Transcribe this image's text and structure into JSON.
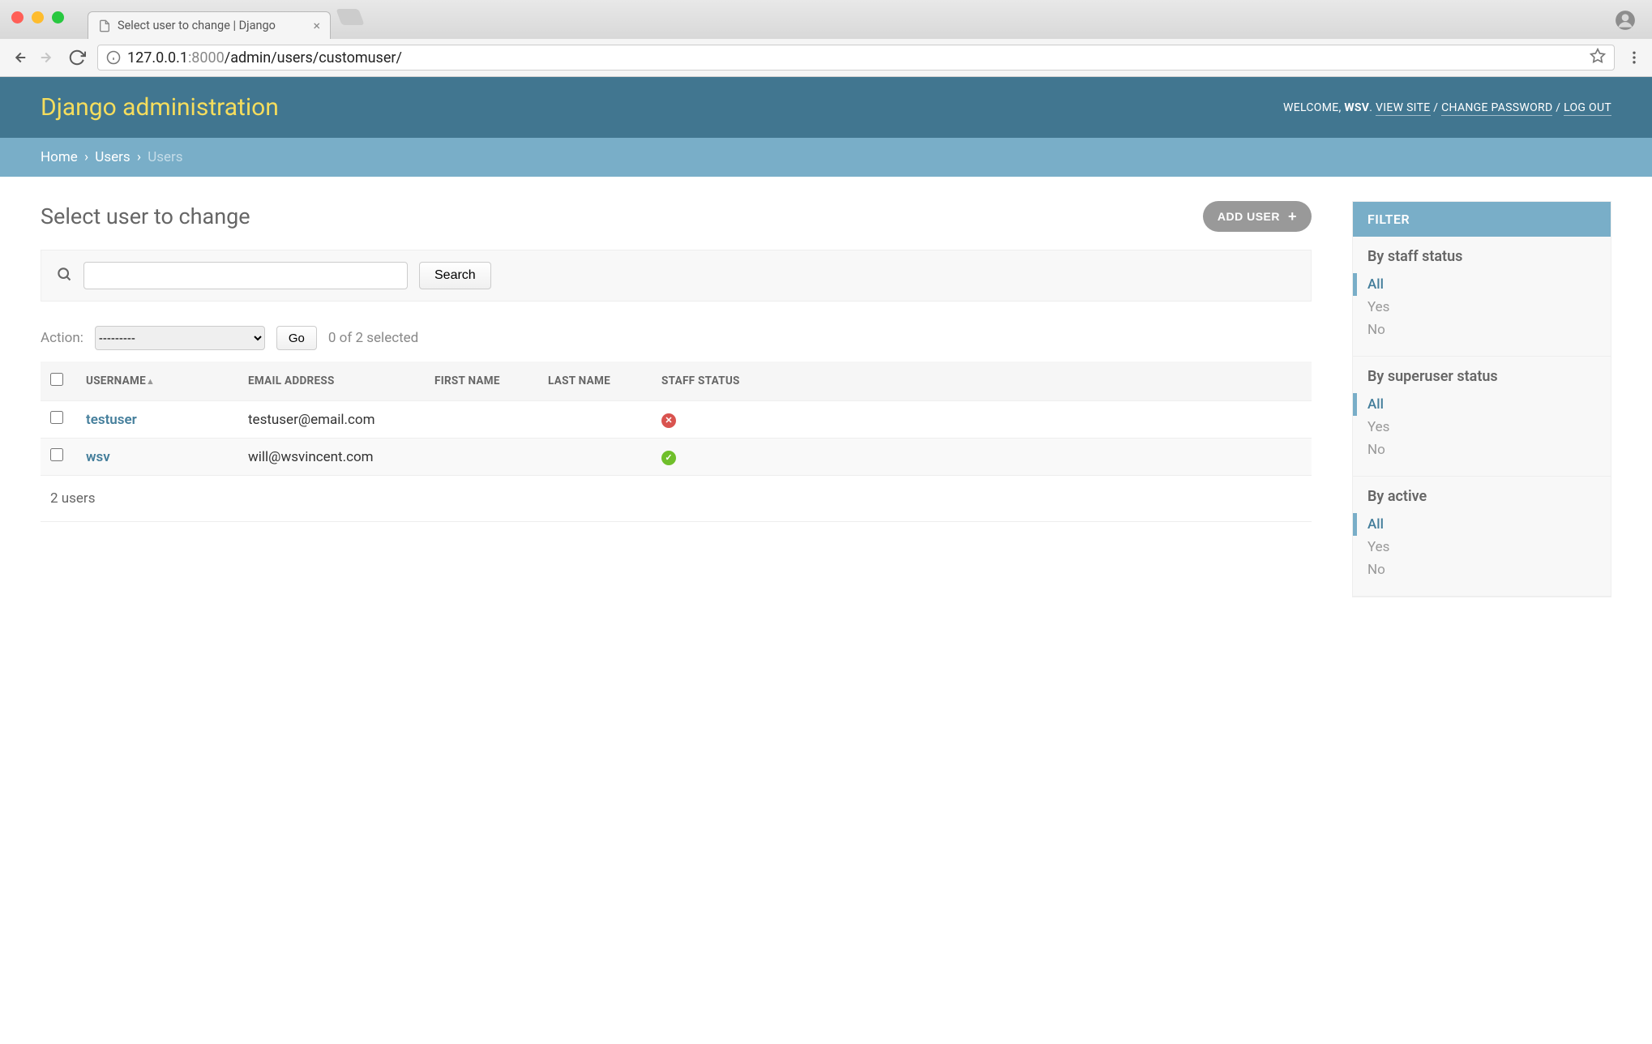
{
  "browser": {
    "tab_title": "Select user to change | Django",
    "url_host": "127.0.0.1",
    "url_port": ":8000",
    "url_path": "/admin/users/customuser/"
  },
  "header": {
    "site_title": "Django administration",
    "welcome": "WELCOME, ",
    "user": "WSV",
    "view_site": "VIEW SITE",
    "change_password": "CHANGE PASSWORD",
    "log_out": "LOG OUT"
  },
  "breadcrumb": {
    "home": "Home",
    "app": "Users",
    "model": "Users"
  },
  "page": {
    "title": "Select user to change",
    "add_button": "ADD USER",
    "search_button": "Search",
    "action_label": "Action:",
    "action_placeholder": "---------",
    "go_label": "Go",
    "selection_text": "0 of 2 selected",
    "count_text": "2 users"
  },
  "columns": {
    "username": "USERNAME",
    "email": "EMAIL ADDRESS",
    "first_name": "FIRST NAME",
    "last_name": "LAST NAME",
    "staff": "STAFF STATUS"
  },
  "rows": [
    {
      "username": "testuser",
      "email": "testuser@email.com",
      "first_name": "",
      "last_name": "",
      "staff": false
    },
    {
      "username": "wsv",
      "email": "will@wsvincent.com",
      "first_name": "",
      "last_name": "",
      "staff": true
    }
  ],
  "filter": {
    "title": "FILTER",
    "groups": [
      {
        "label": "By staff status",
        "options": [
          "All",
          "Yes",
          "No"
        ],
        "selected": "All"
      },
      {
        "label": "By superuser status",
        "options": [
          "All",
          "Yes",
          "No"
        ],
        "selected": "All"
      },
      {
        "label": "By active",
        "options": [
          "All",
          "Yes",
          "No"
        ],
        "selected": "All"
      }
    ]
  }
}
